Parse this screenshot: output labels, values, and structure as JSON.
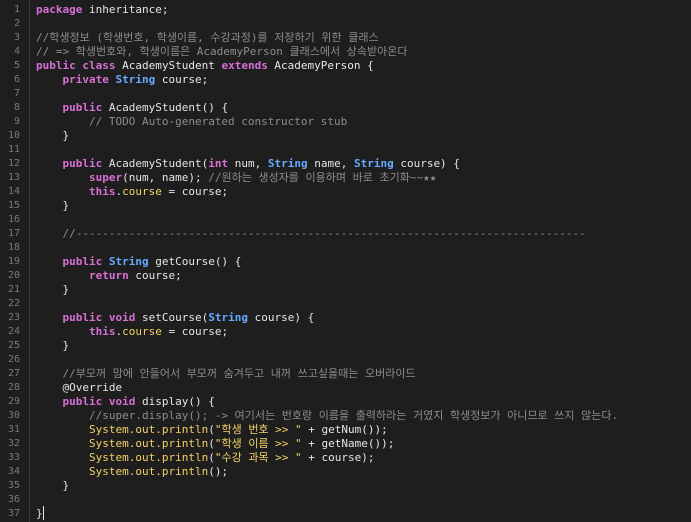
{
  "lines": [
    {
      "n": "1",
      "t": [
        [
          "kw",
          "package"
        ],
        [
          "p",
          " inheritance;"
        ]
      ]
    },
    {
      "n": "2",
      "t": []
    },
    {
      "n": "3",
      "t": [
        [
          "cm",
          "//학생정보 (학생번호, 학생이름, 수강과정)를 저장하기 위한 클래스"
        ]
      ]
    },
    {
      "n": "4",
      "t": [
        [
          "cm",
          "// => 학생번호와, 학생이름은 AcademyPerson 클래스에서 상속받아온다"
        ]
      ]
    },
    {
      "n": "5",
      "t": [
        [
          "kw",
          "public class"
        ],
        [
          "id",
          " AcademyStudent "
        ],
        [
          "kw",
          "extends"
        ],
        [
          "id",
          " AcademyPerson {"
        ]
      ]
    },
    {
      "n": "6",
      "t": [
        [
          "p",
          "    "
        ],
        [
          "kw",
          "private"
        ],
        [
          "p",
          " "
        ],
        [
          "type",
          "String"
        ],
        [
          "p",
          " course;"
        ]
      ]
    },
    {
      "n": "7",
      "t": []
    },
    {
      "n": "8",
      "t": [
        [
          "p",
          "    "
        ],
        [
          "kw",
          "public"
        ],
        [
          "p",
          " AcademyStudent() {"
        ]
      ]
    },
    {
      "n": "9",
      "t": [
        [
          "p",
          "        "
        ],
        [
          "cm",
          "// TODO Auto-generated constructor stub"
        ]
      ]
    },
    {
      "n": "10",
      "t": [
        [
          "p",
          "    }"
        ]
      ]
    },
    {
      "n": "11",
      "t": []
    },
    {
      "n": "12",
      "t": [
        [
          "p",
          "    "
        ],
        [
          "kw",
          "public"
        ],
        [
          "p",
          " AcademyStudent("
        ],
        [
          "kw",
          "int"
        ],
        [
          "p",
          " num, "
        ],
        [
          "type",
          "String"
        ],
        [
          "p",
          " name, "
        ],
        [
          "type",
          "String"
        ],
        [
          "p",
          " course) {"
        ]
      ]
    },
    {
      "n": "13",
      "t": [
        [
          "p",
          "        "
        ],
        [
          "kw",
          "super"
        ],
        [
          "p",
          "(num, name); "
        ],
        [
          "cm",
          "//원하는 생성자를 이용하며 바로 초기화~~★★"
        ]
      ]
    },
    {
      "n": "14",
      "t": [
        [
          "p",
          "        "
        ],
        [
          "kw",
          "this"
        ],
        [
          "p",
          "."
        ],
        [
          "fld",
          "course"
        ],
        [
          "p",
          " = course;"
        ]
      ]
    },
    {
      "n": "15",
      "t": [
        [
          "p",
          "    }"
        ]
      ]
    },
    {
      "n": "16",
      "t": []
    },
    {
      "n": "17",
      "t": [
        [
          "p",
          "    "
        ],
        [
          "cm",
          "//-----------------------------------------------------------------------------"
        ]
      ]
    },
    {
      "n": "18",
      "t": []
    },
    {
      "n": "19",
      "t": [
        [
          "p",
          "    "
        ],
        [
          "kw",
          "public"
        ],
        [
          "p",
          " "
        ],
        [
          "type",
          "String"
        ],
        [
          "p",
          " getCourse() {"
        ]
      ]
    },
    {
      "n": "20",
      "t": [
        [
          "p",
          "        "
        ],
        [
          "kw",
          "return"
        ],
        [
          "p",
          " course;"
        ]
      ]
    },
    {
      "n": "21",
      "t": [
        [
          "p",
          "    }"
        ]
      ]
    },
    {
      "n": "22",
      "t": []
    },
    {
      "n": "23",
      "t": [
        [
          "p",
          "    "
        ],
        [
          "kw",
          "public void"
        ],
        [
          "p",
          " setCourse("
        ],
        [
          "type",
          "String"
        ],
        [
          "p",
          " course) {"
        ]
      ]
    },
    {
      "n": "24",
      "t": [
        [
          "p",
          "        "
        ],
        [
          "kw",
          "this"
        ],
        [
          "p",
          "."
        ],
        [
          "fld",
          "course"
        ],
        [
          "p",
          " = course;"
        ]
      ]
    },
    {
      "n": "25",
      "t": [
        [
          "p",
          "    }"
        ]
      ]
    },
    {
      "n": "26",
      "t": []
    },
    {
      "n": "27",
      "t": [
        [
          "p",
          "    "
        ],
        [
          "cm",
          "//부모꺼 맘에 안들어서 부모꺼 숨겨두고 내꺼 쓰고싶을때는 오버라이드"
        ]
      ]
    },
    {
      "n": "28",
      "t": [
        [
          "p",
          "    "
        ],
        [
          "ann",
          "@Override"
        ]
      ]
    },
    {
      "n": "29",
      "t": [
        [
          "p",
          "    "
        ],
        [
          "kw",
          "public void"
        ],
        [
          "p",
          " display() {"
        ]
      ]
    },
    {
      "n": "30",
      "t": [
        [
          "p",
          "        "
        ],
        [
          "cm",
          "//super.display(); -> 여기서는 번호랑 이름을 출력하라는 거였지 학생정보가 아니므로 쓰지 않는다."
        ]
      ]
    },
    {
      "n": "31",
      "t": [
        [
          "p",
          "        "
        ],
        [
          "fld",
          "System.out.println"
        ],
        [
          "p",
          "("
        ],
        [
          "str",
          "\"학생 번호 >> \""
        ],
        [
          "p",
          " + getNum());"
        ]
      ]
    },
    {
      "n": "32",
      "t": [
        [
          "p",
          "        "
        ],
        [
          "fld",
          "System.out.println"
        ],
        [
          "p",
          "("
        ],
        [
          "str",
          "\"학생 이름 >> \""
        ],
        [
          "p",
          " + getName());"
        ]
      ]
    },
    {
      "n": "33",
      "t": [
        [
          "p",
          "        "
        ],
        [
          "fld",
          "System.out.println"
        ],
        [
          "p",
          "("
        ],
        [
          "str",
          "\"수강 과목 >> \""
        ],
        [
          "p",
          " + course);"
        ]
      ]
    },
    {
      "n": "34",
      "t": [
        [
          "p",
          "        "
        ],
        [
          "fld",
          "System.out.println"
        ],
        [
          "p",
          "();"
        ]
      ]
    },
    {
      "n": "35",
      "t": [
        [
          "p",
          "    }"
        ]
      ]
    },
    {
      "n": "36",
      "t": []
    },
    {
      "n": "37",
      "t": [
        [
          "p",
          "}"
        ]
      ]
    }
  ]
}
